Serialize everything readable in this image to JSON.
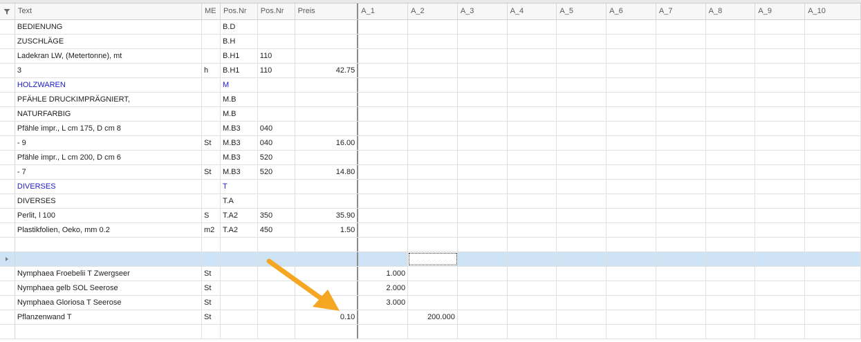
{
  "columns": {
    "text": "Text",
    "me": "ME",
    "pos1": "Pos.Nr",
    "pos2": "Pos.Nr",
    "preis": "Preis",
    "a": [
      "A_1",
      "A_2",
      "A_3",
      "A_4",
      "A_5",
      "A_6",
      "A_7",
      "A_8",
      "A_9",
      "A_10"
    ]
  },
  "rows": [
    {
      "text": "BEDIENUNG",
      "me": "",
      "pos1": "B.D",
      "pos2": "",
      "preis": "",
      "a": [
        "",
        "",
        "",
        "",
        "",
        "",
        "",
        "",
        "",
        ""
      ]
    },
    {
      "text": "ZUSCHLÄGE",
      "me": "",
      "pos1": "B.H",
      "pos2": "",
      "preis": "",
      "a": [
        "",
        "",
        "",
        "",
        "",
        "",
        "",
        "",
        "",
        ""
      ]
    },
    {
      "text": "Ladekran LW, (Metertonne), mt",
      "me": "",
      "pos1": "B.H1",
      "pos2": "110",
      "preis": "",
      "a": [
        "",
        "",
        "",
        "",
        "",
        "",
        "",
        "",
        "",
        ""
      ]
    },
    {
      "text": "3",
      "me": "h",
      "pos1": "B.H1",
      "pos2": "110",
      "preis": "42.75",
      "a": [
        "",
        "",
        "",
        "",
        "",
        "",
        "",
        "",
        "",
        ""
      ]
    },
    {
      "text": "HOLZWAREN",
      "me": "",
      "pos1": "M",
      "pos2": "",
      "preis": "",
      "a": [
        "",
        "",
        "",
        "",
        "",
        "",
        "",
        "",
        "",
        ""
      ],
      "blue": true
    },
    {
      "text": "PFÄHLE DRUCKIMPRÄGNIERT,",
      "me": "",
      "pos1": "M.B",
      "pos2": "",
      "preis": "",
      "a": [
        "",
        "",
        "",
        "",
        "",
        "",
        "",
        "",
        "",
        ""
      ]
    },
    {
      "text": "NATURFARBIG",
      "me": "",
      "pos1": "M.B",
      "pos2": "",
      "preis": "",
      "a": [
        "",
        "",
        "",
        "",
        "",
        "",
        "",
        "",
        "",
        ""
      ]
    },
    {
      "text": "Pfähle impr., L cm 175, D cm 8",
      "me": "",
      "pos1": "M.B3",
      "pos2": "040",
      "preis": "",
      "a": [
        "",
        "",
        "",
        "",
        "",
        "",
        "",
        "",
        "",
        ""
      ]
    },
    {
      "text": "- 9",
      "me": "St",
      "pos1": "M.B3",
      "pos2": "040",
      "preis": "16.00",
      "a": [
        "",
        "",
        "",
        "",
        "",
        "",
        "",
        "",
        "",
        ""
      ]
    },
    {
      "text": "Pfähle impr., L cm 200, D cm 6",
      "me": "",
      "pos1": "M.B3",
      "pos2": "520",
      "preis": "",
      "a": [
        "",
        "",
        "",
        "",
        "",
        "",
        "",
        "",
        "",
        ""
      ]
    },
    {
      "text": "- 7",
      "me": "St",
      "pos1": "M.B3",
      "pos2": "520",
      "preis": "14.80",
      "a": [
        "",
        "",
        "",
        "",
        "",
        "",
        "",
        "",
        "",
        ""
      ]
    },
    {
      "text": "DIVERSES",
      "me": "",
      "pos1": "T",
      "pos2": "",
      "preis": "",
      "a": [
        "",
        "",
        "",
        "",
        "",
        "",
        "",
        "",
        "",
        ""
      ],
      "blue": true
    },
    {
      "text": "DIVERSES",
      "me": "",
      "pos1": "T.A",
      "pos2": "",
      "preis": "",
      "a": [
        "",
        "",
        "",
        "",
        "",
        "",
        "",
        "",
        "",
        ""
      ]
    },
    {
      "text": "Perlit, l 100",
      "me": "S",
      "pos1": "T.A2",
      "pos2": "350",
      "preis": "35.90",
      "a": [
        "",
        "",
        "",
        "",
        "",
        "",
        "",
        "",
        "",
        ""
      ]
    },
    {
      "text": "Plastikfolien, Oeko, mm 0.2",
      "me": "m2",
      "pos1": "T.A2",
      "pos2": "450",
      "preis": "1.50",
      "a": [
        "",
        "",
        "",
        "",
        "",
        "",
        "",
        "",
        "",
        ""
      ]
    },
    {
      "text": "",
      "me": "",
      "pos1": "",
      "pos2": "",
      "preis": "",
      "a": [
        "",
        "",
        "",
        "",
        "",
        "",
        "",
        "",
        "",
        ""
      ]
    },
    {
      "text": "",
      "me": "",
      "pos1": "",
      "pos2": "",
      "preis": "",
      "a": [
        "",
        "",
        "",
        "",
        "",
        "",
        "",
        "",
        "",
        ""
      ],
      "selected": true
    },
    {
      "text": "Nymphaea Froebelii T Zwergseer",
      "me": "St",
      "pos1": "",
      "pos2": "",
      "preis": "",
      "a": [
        "1.000",
        "",
        "",
        "",
        "",
        "",
        "",
        "",
        "",
        ""
      ]
    },
    {
      "text": "Nymphaea gelb SOL Seerose",
      "me": "St",
      "pos1": "",
      "pos2": "",
      "preis": "",
      "a": [
        "2.000",
        "",
        "",
        "",
        "",
        "",
        "",
        "",
        "",
        ""
      ]
    },
    {
      "text": "Nymphaea Gloriosa T Seerose",
      "me": "St",
      "pos1": "",
      "pos2": "",
      "preis": "",
      "a": [
        "3.000",
        "",
        "",
        "",
        "",
        "",
        "",
        "",
        "",
        ""
      ]
    },
    {
      "text": "Pflanzenwand T",
      "me": "St",
      "pos1": "",
      "pos2": "",
      "preis": "0.10",
      "a": [
        "",
        "200.000",
        "",
        "",
        "",
        "",
        "",
        "",
        "",
        ""
      ]
    },
    {
      "text": "",
      "me": "",
      "pos1": "",
      "pos2": "",
      "preis": "",
      "a": [
        "",
        "",
        "",
        "",
        "",
        "",
        "",
        "",
        "",
        ""
      ]
    }
  ],
  "colors": {
    "blue_text": "#1a1ac8",
    "selected_row": "#cfe3f7",
    "arrow": "#f5a623"
  },
  "icons": {
    "filter": "filter-icon",
    "row_indicator": "row-indicator-icon",
    "annotation": "arrow-annotation-icon"
  }
}
